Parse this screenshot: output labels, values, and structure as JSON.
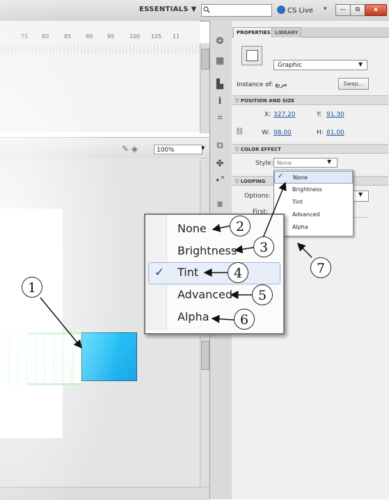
{
  "topbar": {
    "workspace": "ESSENTIALS ▼",
    "search_placeholder": "",
    "cs_live": "CS Live",
    "window_min": "—",
    "window_max": "⧉",
    "window_close": "x"
  },
  "timeline": {
    "ruler": [
      "75",
      "80",
      "85",
      "90",
      "95",
      "100",
      "105",
      "11"
    ]
  },
  "stage": {
    "zoom": "100%"
  },
  "panel": {
    "tabs": [
      "PROPERTIES",
      "LIBRARY"
    ],
    "symbol_type": "Graphic",
    "instance_of_label": "Instance of:",
    "instance_of_value": "مربع",
    "swap_button": "Swap...",
    "position_section": "POSITION AND SIZE",
    "x_label": "X:",
    "x_value": "327.20",
    "y_label": "Y:",
    "y_value": "91.30",
    "w_label": "W:",
    "w_value": "98.00",
    "h_label": "H:",
    "h_value": "81.00",
    "color_section": "COLOR EFFECT",
    "style_label": "Style:",
    "style_value": "None",
    "looping_section": "LOOPING",
    "options_label": "Options:",
    "first_label": "First:"
  },
  "style_menu": {
    "items": [
      "None",
      "Brightness",
      "Tint",
      "Advanced",
      "Alpha"
    ],
    "selected_index": 0
  },
  "zoomed_menu": {
    "items": [
      "None",
      "Brightness",
      "Tint",
      "Advanced",
      "Alpha"
    ],
    "checked_index": 2
  },
  "callouts": [
    "1",
    "2",
    "3",
    "4",
    "5",
    "6",
    "7"
  ],
  "colors": {
    "object_fill": "#1fb6f0",
    "onion_skin": "#b5ecb8",
    "menu_highlight": "#e7eefa",
    "link_value": "#1f53a8"
  }
}
